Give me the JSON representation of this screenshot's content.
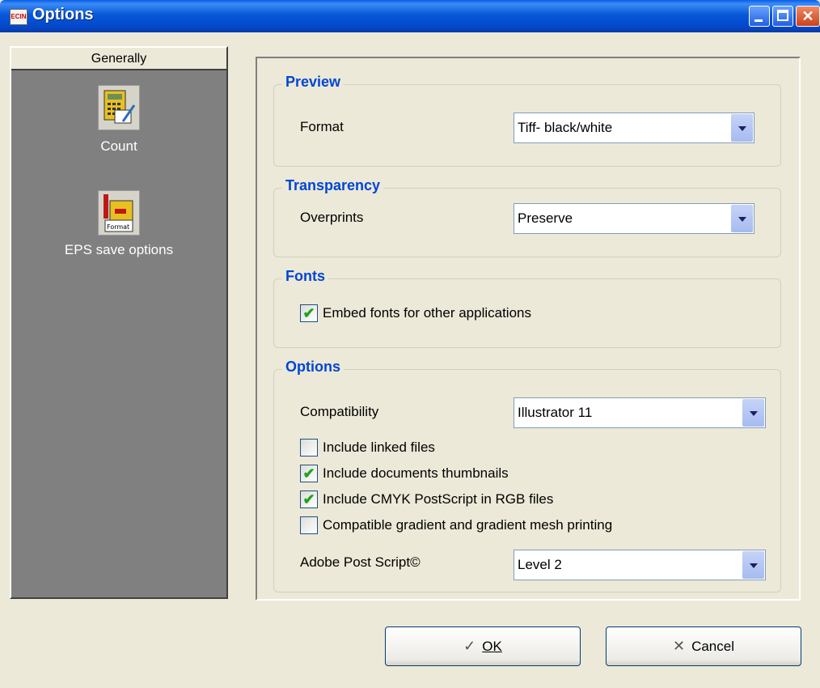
{
  "window": {
    "title": "Options",
    "app_icon_text": "ECIN"
  },
  "sidebar": {
    "header": "Generally",
    "items": [
      {
        "label": "Count",
        "icon": "calculator-icon"
      },
      {
        "label": "EPS save options",
        "icon": "format-icon"
      }
    ]
  },
  "groups": {
    "preview": {
      "title": "Preview",
      "format_label": "Format",
      "format_value": "Tiff- black/white"
    },
    "transparency": {
      "title": "Transparency",
      "overprints_label": "Overprints",
      "overprints_value": "Preserve"
    },
    "fonts": {
      "title": "Fonts",
      "embed_label": "Embed fonts for other applications",
      "embed_checked": true
    },
    "options": {
      "title": "Options",
      "compatibility_label": "Compatibility",
      "compatibility_value": "Illustrator 11",
      "checkboxes": [
        {
          "label": "Include linked files",
          "checked": false
        },
        {
          "label": "Include documents thumbnails",
          "checked": true
        },
        {
          "label": "Include CMYK PostScript in RGB files",
          "checked": true
        },
        {
          "label": "Compatible gradient and gradient mesh printing",
          "checked": false
        }
      ],
      "postscript_label": "Adobe Post Script©",
      "postscript_value": "Level 2"
    }
  },
  "buttons": {
    "ok": "OK",
    "cancel": "Cancel"
  }
}
